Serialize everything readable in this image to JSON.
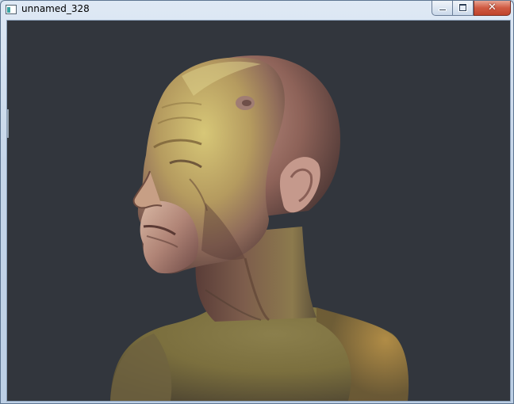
{
  "window": {
    "title": "unnamed_328",
    "controls": {
      "minimize_icon": "minimize-icon",
      "maximize_icon": "maximize-icon",
      "close_icon": "close-icon"
    }
  },
  "viewport": {
    "background_color": "#32363d",
    "content": "3d-sculpted-head-render"
  }
}
